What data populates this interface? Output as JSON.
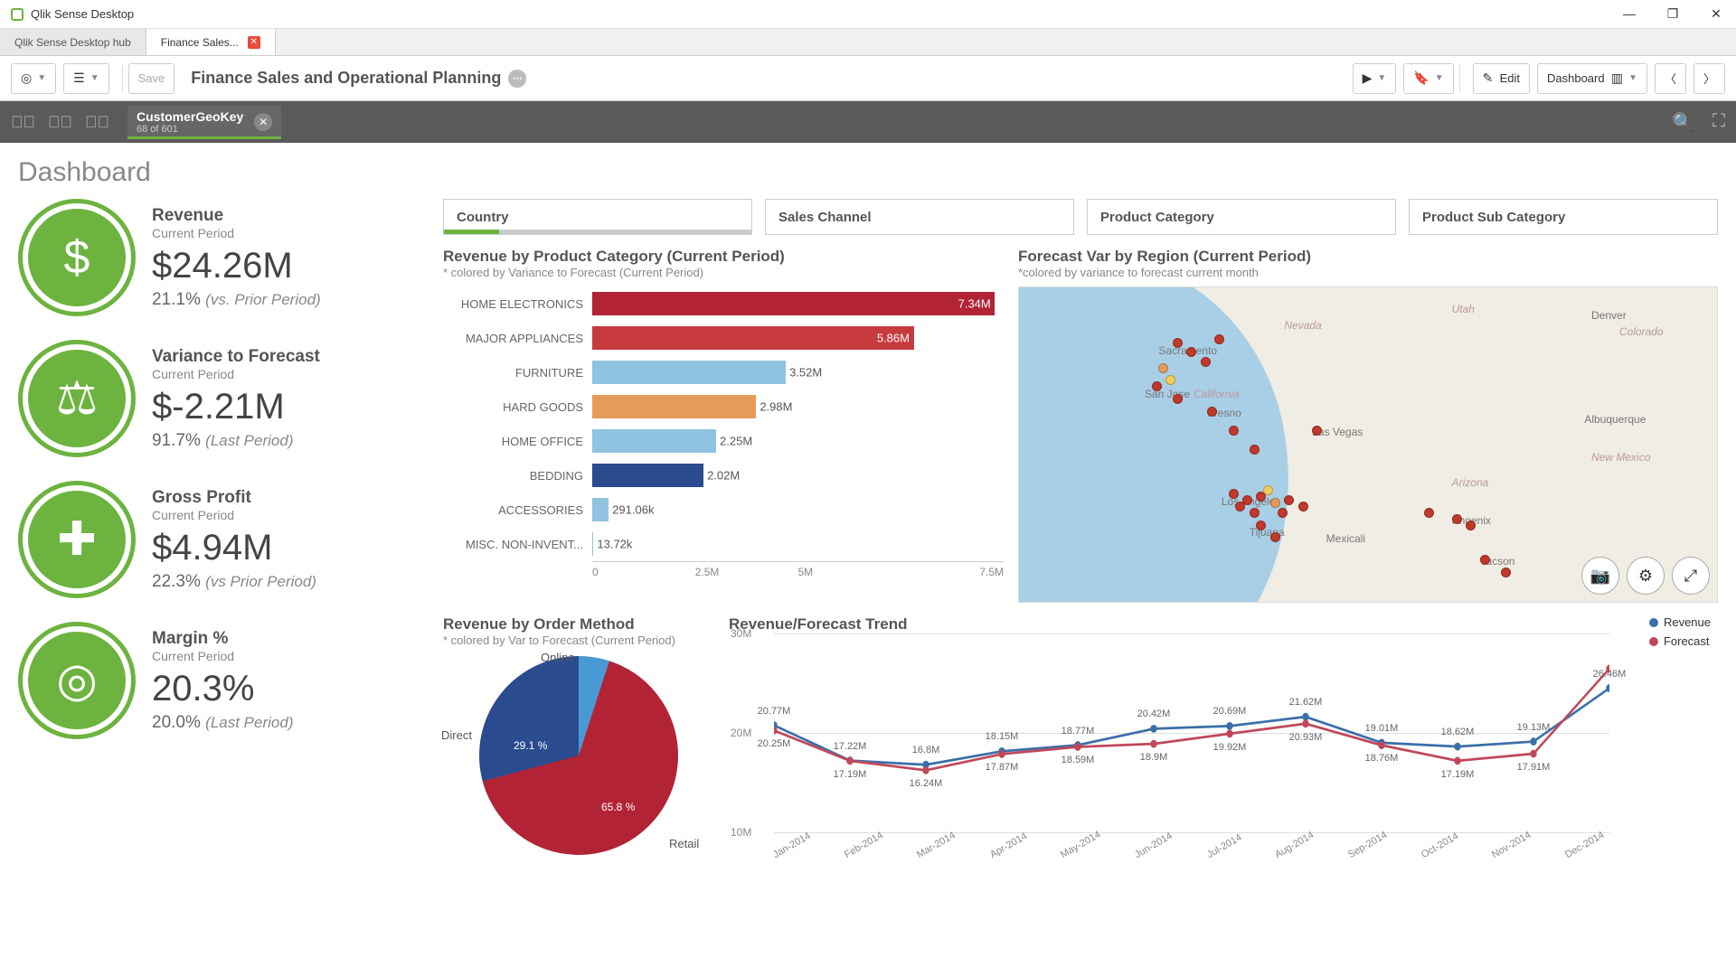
{
  "app_title": "Qlik Sense Desktop",
  "tabs": {
    "hub": "Qlik Sense Desktop hub",
    "active": "Finance Sales..."
  },
  "toolbar": {
    "save": "Save",
    "sheet_title": "Finance Sales and Operational Planning",
    "edit": "Edit",
    "view": "Dashboard"
  },
  "selection": {
    "field": "CustomerGeoKey",
    "count": "68 of 601"
  },
  "page_title": "Dashboard",
  "kpis": [
    {
      "name": "Revenue",
      "sub": "Current Period",
      "value": "$24.26M",
      "change": "21.1%",
      "note": "(vs. Prior Period)",
      "icon": "$"
    },
    {
      "name": "Variance to Forecast",
      "sub": "Current Period",
      "value": "$-2.21M",
      "change": "91.7%",
      "note": "(Last Period)",
      "icon": "⚖"
    },
    {
      "name": "Gross Profit",
      "sub": "Current Period",
      "value": "$4.94M",
      "change": "22.3%",
      "note": "(vs Prior Period)",
      "icon": "✚"
    },
    {
      "name": "Margin %",
      "sub": "Current Period",
      "value": "20.3%",
      "change": "20.0%",
      "note": "(Last Period)",
      "icon": "◎"
    }
  ],
  "filters": [
    "Country",
    "Sales Channel",
    "Product Category",
    "Product Sub Category"
  ],
  "bar": {
    "title": "Revenue by Product Category (Current Period)",
    "sub": "* colored by Variance to Forecast (Current Period)",
    "axis": [
      "0",
      "2.5M",
      "5M",
      "7.5M"
    ]
  },
  "map": {
    "title": "Forecast Var by Region (Current Period)",
    "sub": "*colored by variance to forecast current month",
    "cities": [
      "Denver",
      "Sacramento",
      "San Jose",
      "Fresno",
      "Las Vegas",
      "Albuquerque",
      "Los Angeles",
      "Phoenix",
      "Tucson",
      "Mexicali",
      "Tijuana"
    ],
    "states": [
      "Utah",
      "Nevada",
      "California",
      "Colorado",
      "Arizona",
      "New Mexico"
    ]
  },
  "pie": {
    "title": "Revenue by Order Method",
    "sub": "* colored by Var to Forecast (Current Period)",
    "labels": {
      "online": "Online",
      "direct": "Direct",
      "retail": "Retail"
    },
    "pct": {
      "direct": "29.1 %",
      "retail": "65.8 %"
    }
  },
  "trend": {
    "title": "Revenue/Forecast Trend",
    "y": [
      "10M",
      "20M",
      "30M"
    ],
    "x": [
      "Jan-2014",
      "Feb-2014",
      "Mar-2014",
      "Apr-2014",
      "May-2014",
      "Jun-2014",
      "Jul-2014",
      "Aug-2014",
      "Sep-2014",
      "Oct-2014",
      "Nov-2014",
      "Dec-2014"
    ],
    "legend": {
      "revenue": "Revenue",
      "forecast": "Forecast"
    },
    "rev_labels": [
      "20.77M",
      "17.22M",
      "16.8M",
      "18.15M",
      "18.77M",
      "20.42M",
      "20.69M",
      "21.62M",
      "19.01M",
      "18.62M",
      "19.13M",
      "26.46M"
    ],
    "fc_labels": [
      "20.25M",
      "17.19M",
      "16.24M",
      "17.87M",
      "18.59M",
      "18.9M",
      "19.92M",
      "20.93M",
      "18.76M",
      "17.19M",
      "17.91M",
      ""
    ]
  },
  "chart_data": [
    {
      "type": "bar",
      "title": "Revenue by Product Category (Current Period)",
      "xlabel": "",
      "ylabel": "",
      "ylim": [
        0,
        7.5
      ],
      "categories": [
        "HOME ELECTRONICS",
        "MAJOR APPLIANCES",
        "FURNITURE",
        "HARD GOODS",
        "HOME OFFICE",
        "BEDDING",
        "ACCESSORIES",
        "MISC. NON-INVENT..."
      ],
      "values_m": [
        7.34,
        5.86,
        3.52,
        2.98,
        2.25,
        2.02,
        0.29106,
        0.01372
      ],
      "value_labels": [
        "7.34M",
        "5.86M",
        "3.52M",
        "2.98M",
        "2.25M",
        "2.02M",
        "291.06k",
        "13.72k"
      ],
      "colors": [
        "#b22335",
        "#c73a3d",
        "#8fc3e0",
        "#e79b5b",
        "#8fc3e0",
        "#2b4b8f",
        "#8fc3e0",
        "#8fc3e0"
      ]
    },
    {
      "type": "pie",
      "title": "Revenue by Order Method",
      "series": [
        {
          "name": "Online",
          "value": 5.1
        },
        {
          "name": "Retail",
          "value": 65.8
        },
        {
          "name": "Direct",
          "value": 29.1
        }
      ]
    },
    {
      "type": "line",
      "title": "Revenue/Forecast Trend",
      "xlabel": "",
      "ylabel": "",
      "ylim": [
        10,
        30
      ],
      "x": [
        "Jan-2014",
        "Feb-2014",
        "Mar-2014",
        "Apr-2014",
        "May-2014",
        "Jun-2014",
        "Jul-2014",
        "Aug-2014",
        "Sep-2014",
        "Oct-2014",
        "Nov-2014",
        "Dec-2014"
      ],
      "series": [
        {
          "name": "Revenue",
          "values": [
            20.77,
            17.22,
            16.8,
            18.15,
            18.77,
            20.42,
            20.69,
            21.62,
            19.01,
            18.62,
            19.13,
            24.5
          ]
        },
        {
          "name": "Forecast",
          "values": [
            20.25,
            17.19,
            16.24,
            17.87,
            18.59,
            18.9,
            19.92,
            20.93,
            18.76,
            17.19,
            17.91,
            26.46
          ]
        }
      ]
    }
  ]
}
